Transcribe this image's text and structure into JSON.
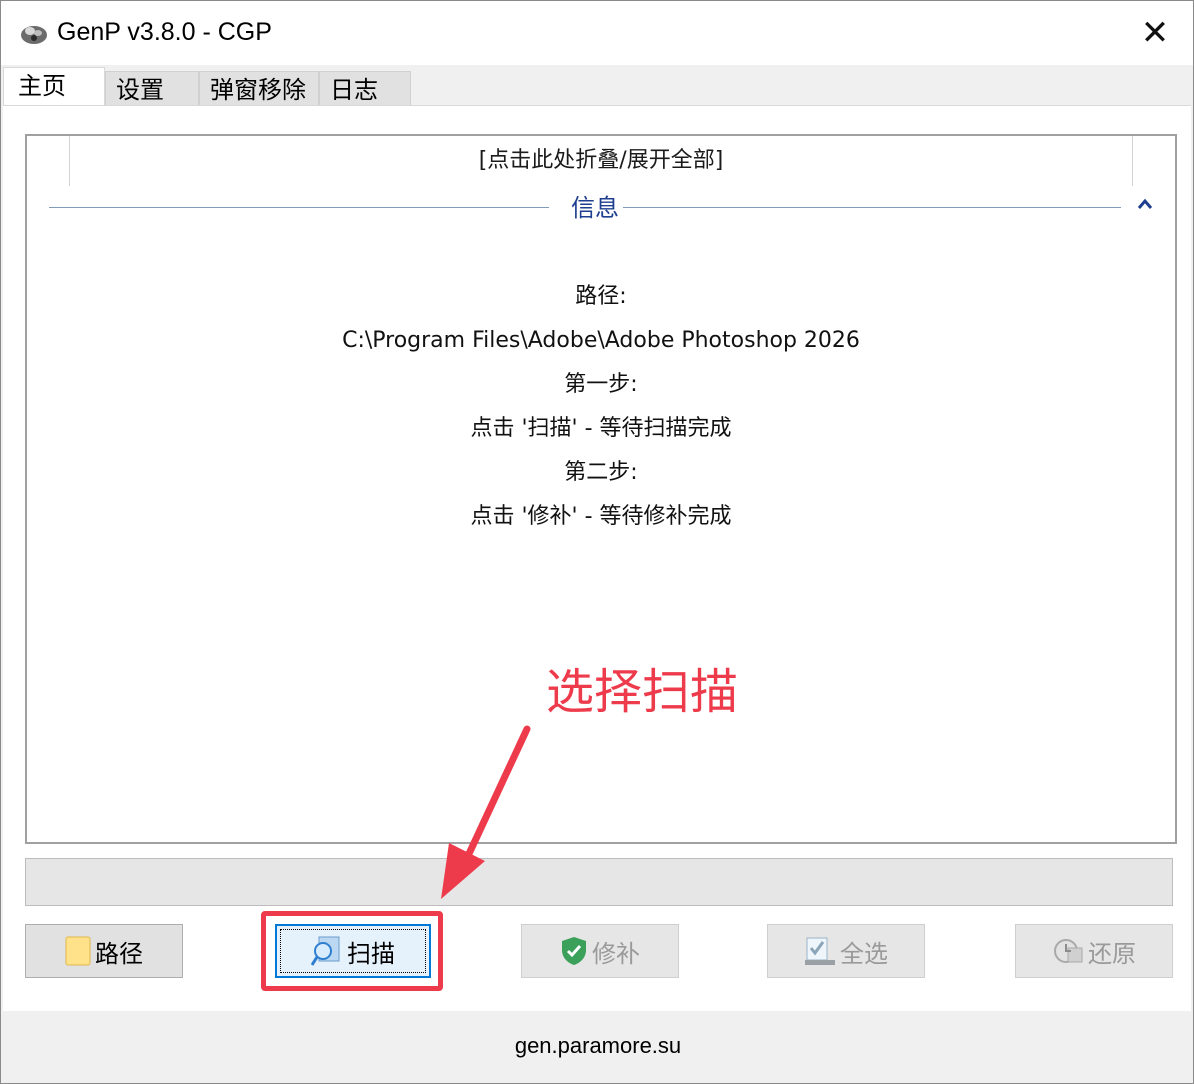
{
  "window": {
    "title": "GenP v3.8.0 - CGP",
    "close_glyph": "✕"
  },
  "tabs": [
    {
      "label": "主页",
      "active": true
    },
    {
      "label": "设置",
      "active": false
    },
    {
      "label": "弹窗移除",
      "active": false
    },
    {
      "label": "日志",
      "active": false
    }
  ],
  "info_panel": {
    "collapse_toggle": "[点击此处折叠/展开全部]",
    "group_title": "信息",
    "lines": [
      "路径:",
      "C:\\Program Files\\Adobe\\Adobe Photoshop 2026",
      "第一步:",
      "点击 '扫描' - 等待扫描完成",
      "第二步:",
      "点击 '修补' - 等待修补完成"
    ]
  },
  "buttons": {
    "path": {
      "label": "路径",
      "icon": "folder-icon",
      "enabled": true
    },
    "scan": {
      "label": "扫描",
      "icon": "scan-magnifier-icon",
      "enabled": true,
      "focused": true
    },
    "patch": {
      "label": "修补",
      "icon": "shield-check-icon",
      "enabled": false
    },
    "select_all": {
      "label": "全选",
      "icon": "checkbox-icon",
      "enabled": false
    },
    "restore": {
      "label": "还原",
      "icon": "restore-icon",
      "enabled": false
    }
  },
  "annotation": {
    "text": "选择扫描",
    "color": "#ee3b4c"
  },
  "footer": {
    "link": "gen.paramore.su"
  }
}
